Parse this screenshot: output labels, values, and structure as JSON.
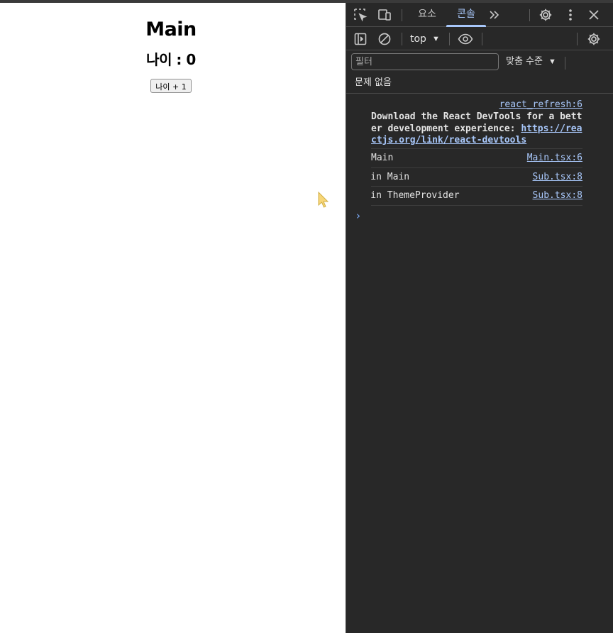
{
  "page": {
    "title": "Main",
    "age_text": "나이 : 0",
    "button_label": "나이 + 1"
  },
  "devtools": {
    "tabs": [
      {
        "label": "요소",
        "active": false
      },
      {
        "label": "콘솔",
        "active": true
      }
    ],
    "context": "top",
    "filter_placeholder": "필터",
    "levels_label": "맞춤 수준",
    "issues_text": "문제 없음",
    "messages": [
      {
        "source": "react_refresh:6",
        "text_prefix": "Download the React DevTools for a better development experience: ",
        "link": "https://reactjs.org/link/react-devtools"
      },
      {
        "text": "Main",
        "source": "Main.tsx:6"
      },
      {
        "text": "    in Main",
        "source": "Sub.tsx:8"
      },
      {
        "text": "    in ThemeProvider",
        "source": "Sub.tsx:8"
      }
    ],
    "prompt_glyph": "›"
  },
  "colors": {
    "devtools_bg": "#282828",
    "accent": "#a8c7fa",
    "text": "#e3e3e3"
  }
}
